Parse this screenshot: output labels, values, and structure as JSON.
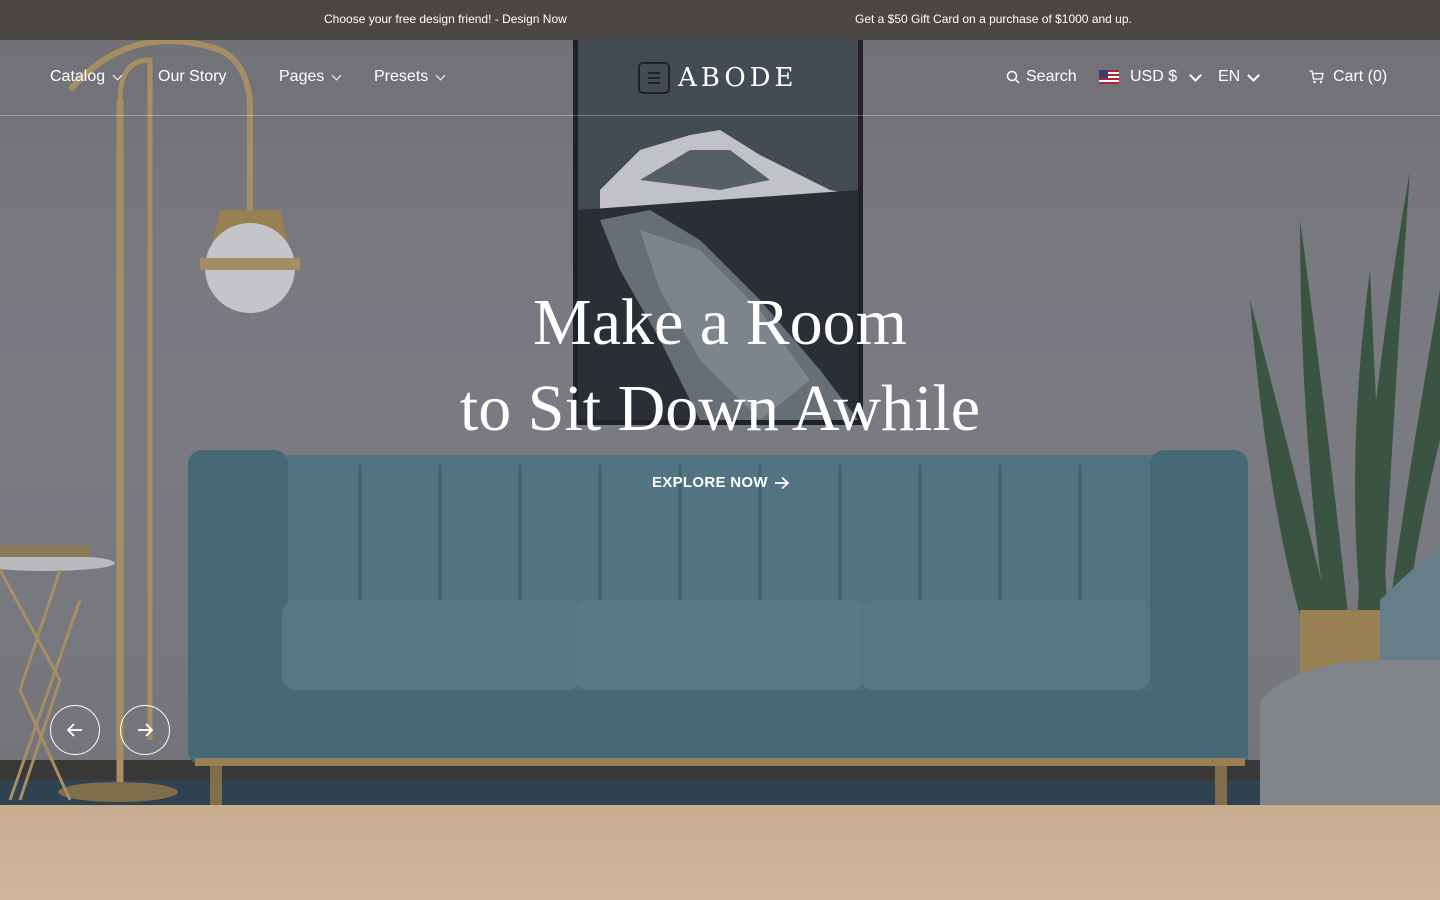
{
  "announcement": {
    "left": "Choose your free design friend! - Design Now",
    "right": "Get a $50 Gift Card on a purchase of $1000 and up."
  },
  "nav": {
    "catalog": "Catalog",
    "our_story": "Our Story",
    "pages": "Pages",
    "presets": "Presets"
  },
  "brand": {
    "name": "ABODE",
    "menu_icon": "menu-icon"
  },
  "utility": {
    "search": "Search",
    "currency": "USD $",
    "language": "EN",
    "cart": "Cart (0)"
  },
  "hero": {
    "line1": "Make a Room",
    "line2": "to Sit Down Awhile",
    "cta": "EXPLORE NOW",
    "prev_icon": "arrow-left-icon",
    "next_icon": "arrow-right-icon"
  },
  "colors": {
    "announce_bg": "#4b4743",
    "sofa": "#4e7787",
    "section_bg": "#cdb094"
  }
}
